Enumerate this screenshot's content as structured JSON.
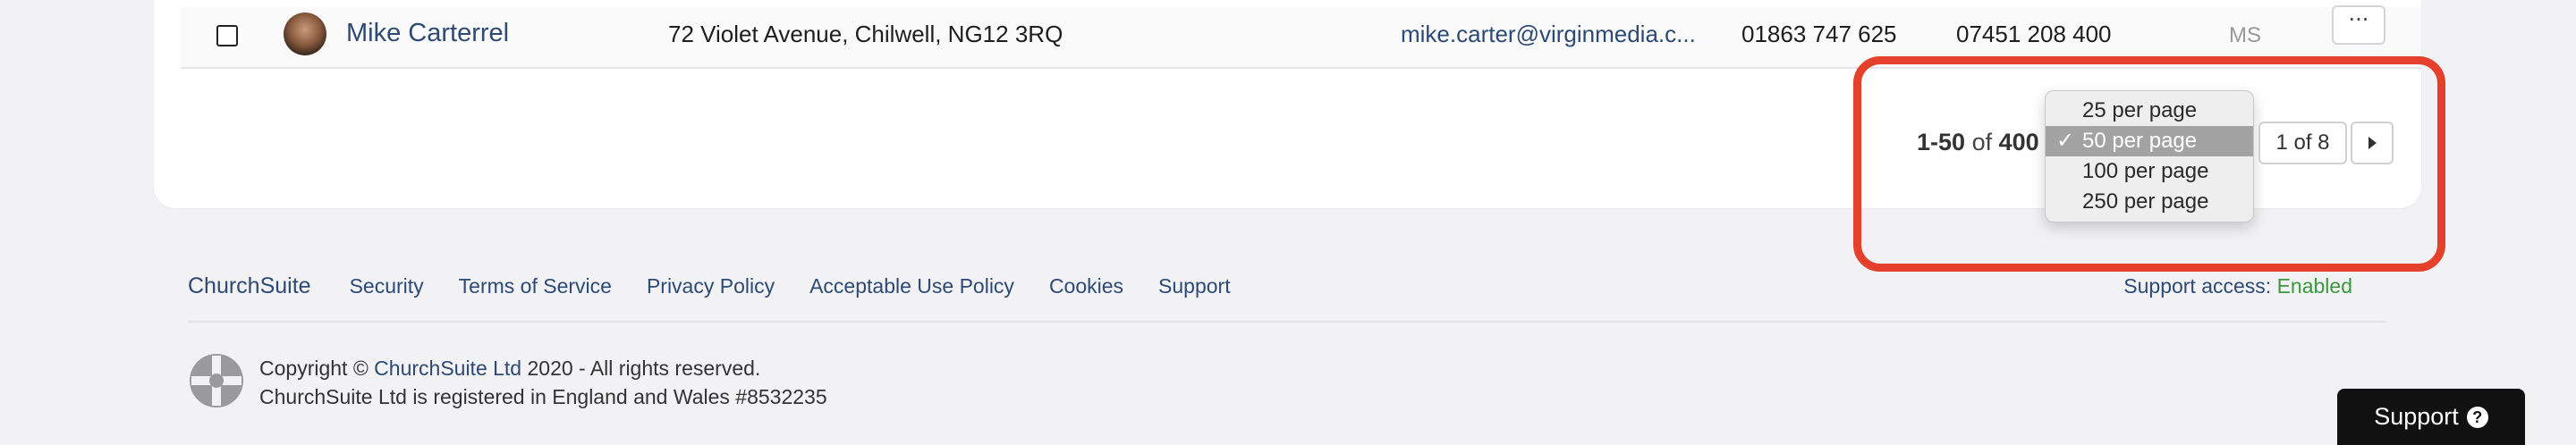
{
  "row": {
    "name": "Mike Carterrel",
    "address": "72 Violet Avenue, Chilwell, NG12 3RQ",
    "email": "mike.carter@virginmedia.c...",
    "phone": "01863 747 625",
    "mobile": "07451 208 400",
    "initials": "MS",
    "more_label": "···"
  },
  "pagination": {
    "range_start_end": "1-50",
    "of_label": "of",
    "total": "400",
    "page_indicator": "1 of 8"
  },
  "per_page_dropdown": {
    "options": [
      {
        "label": "25 per page",
        "selected": false
      },
      {
        "label": "50 per page",
        "selected": true
      },
      {
        "label": "100 per page",
        "selected": false
      },
      {
        "label": "250 per page",
        "selected": false
      }
    ],
    "check_glyph": "✓"
  },
  "footer": {
    "brand": "ChurchSuite",
    "links": [
      "Security",
      "Terms of Service",
      "Privacy Policy",
      "Acceptable Use Policy",
      "Cookies",
      "Support"
    ],
    "support_access_label": "Support access:",
    "support_access_status": "Enabled",
    "copyright_prefix": "Copyright ©",
    "copyright_company": "ChurchSuite Ltd",
    "copyright_suffix": "2020 - All rights reserved.",
    "registration": "ChurchSuite Ltd is registered in England and Wales #8532235"
  },
  "support_button": {
    "label": "Support",
    "icon": "?"
  },
  "colors": {
    "link": "#2c4a75",
    "enabled": "#3a9a3a",
    "highlight": "#e5402b",
    "selected_option": "#a3a3a3"
  }
}
